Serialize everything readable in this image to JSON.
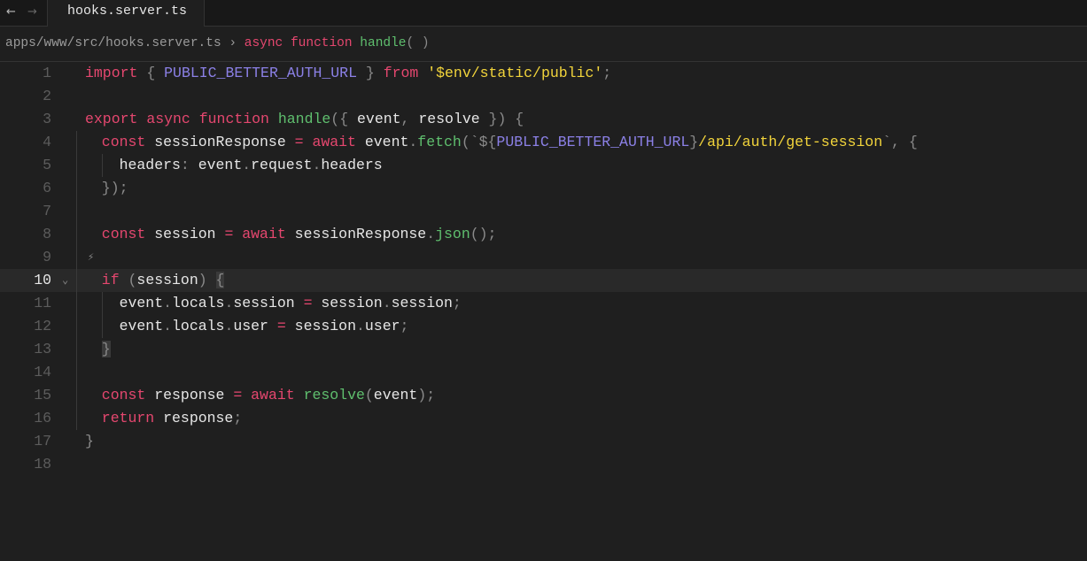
{
  "nav": {
    "back": "←",
    "forward": "→"
  },
  "tab": {
    "label": "hooks.server.ts"
  },
  "breadcrumb": {
    "path": "apps/www/src/hooks.server.ts",
    "sep": "›",
    "kw1": "async",
    "kw2": "function",
    "fn": "handle",
    "parens": "( )"
  },
  "current_line": 10,
  "colors": {
    "keyword": "#e5476f",
    "function": "#5fbf6e",
    "constant": "#8b80e6",
    "string": "#f2d43b",
    "punct": "#8a8a8a",
    "text": "#e6e6e6"
  },
  "lines": [
    {
      "n": "1",
      "indent": 0,
      "t": [
        [
          "kw",
          "import"
        ],
        [
          "pn",
          " { "
        ],
        [
          "cst",
          "PUBLIC_BETTER_AUTH_URL"
        ],
        [
          "pn",
          " } "
        ],
        [
          "kw",
          "from"
        ],
        [
          "pn",
          " "
        ],
        [
          "str",
          "'$env/static/public'"
        ],
        [
          "pn",
          ";"
        ]
      ]
    },
    {
      "n": "2",
      "indent": 0,
      "t": []
    },
    {
      "n": "3",
      "indent": 0,
      "t": [
        [
          "kw",
          "export"
        ],
        [
          "pn",
          " "
        ],
        [
          "kw",
          "async"
        ],
        [
          "pn",
          " "
        ],
        [
          "kw",
          "function"
        ],
        [
          "pn",
          " "
        ],
        [
          "fn",
          "handle"
        ],
        [
          "pn",
          "({ "
        ],
        [
          "id",
          "event"
        ],
        [
          "pn",
          ", "
        ],
        [
          "id",
          "resolve"
        ],
        [
          "pn",
          " }) {"
        ]
      ]
    },
    {
      "n": "4",
      "indent": 1,
      "t": [
        [
          "kw",
          "const"
        ],
        [
          "id",
          " sessionResponse "
        ],
        [
          "kw",
          "="
        ],
        [
          "id",
          " "
        ],
        [
          "kw",
          "await"
        ],
        [
          "id",
          " event"
        ],
        [
          "pn",
          "."
        ],
        [
          "fn",
          "fetch"
        ],
        [
          "pn",
          "(`${"
        ],
        [
          "cst",
          "PUBLIC_BETTER_AUTH_URL"
        ],
        [
          "pn",
          "}"
        ],
        [
          "str",
          "/api/auth/get-session"
        ],
        [
          "pn",
          "`, {"
        ]
      ]
    },
    {
      "n": "5",
      "indent": 2,
      "t": [
        [
          "id",
          "headers"
        ],
        [
          "pn",
          ": "
        ],
        [
          "id",
          "event"
        ],
        [
          "pn",
          "."
        ],
        [
          "id",
          "request"
        ],
        [
          "pn",
          "."
        ],
        [
          "id",
          "headers"
        ]
      ]
    },
    {
      "n": "6",
      "indent": 1,
      "t": [
        [
          "pn",
          "});"
        ]
      ]
    },
    {
      "n": "7",
      "indent": 1,
      "t": []
    },
    {
      "n": "8",
      "indent": 1,
      "t": [
        [
          "kw",
          "const"
        ],
        [
          "id",
          " session "
        ],
        [
          "kw",
          "="
        ],
        [
          "id",
          " "
        ],
        [
          "kw",
          "await"
        ],
        [
          "id",
          " sessionResponse"
        ],
        [
          "pn",
          "."
        ],
        [
          "fn",
          "json"
        ],
        [
          "pn",
          "();"
        ]
      ]
    },
    {
      "n": "9",
      "indent": 1,
      "t": [],
      "bolt": "⚡"
    },
    {
      "n": "10",
      "indent": 1,
      "t": [
        [
          "kw",
          "if"
        ],
        [
          "pn",
          " ("
        ],
        [
          "id",
          "session"
        ],
        [
          "pn",
          ") "
        ],
        [
          "pn hlb",
          "{"
        ]
      ],
      "fold": "⌄"
    },
    {
      "n": "11",
      "indent": 2,
      "t": [
        [
          "id",
          "event"
        ],
        [
          "pn",
          "."
        ],
        [
          "id",
          "locals"
        ],
        [
          "pn",
          "."
        ],
        [
          "id",
          "session "
        ],
        [
          "kw",
          "="
        ],
        [
          "id",
          " session"
        ],
        [
          "pn",
          "."
        ],
        [
          "id",
          "session"
        ],
        [
          "pn",
          ";"
        ]
      ]
    },
    {
      "n": "12",
      "indent": 2,
      "t": [
        [
          "id",
          "event"
        ],
        [
          "pn",
          "."
        ],
        [
          "id",
          "locals"
        ],
        [
          "pn",
          "."
        ],
        [
          "id",
          "user "
        ],
        [
          "kw",
          "="
        ],
        [
          "id",
          " session"
        ],
        [
          "pn",
          "."
        ],
        [
          "id",
          "user"
        ],
        [
          "pn",
          ";"
        ]
      ]
    },
    {
      "n": "13",
      "indent": 1,
      "t": [
        [
          "pn hlb",
          "}"
        ]
      ]
    },
    {
      "n": "14",
      "indent": 1,
      "t": []
    },
    {
      "n": "15",
      "indent": 1,
      "t": [
        [
          "kw",
          "const"
        ],
        [
          "id",
          " response "
        ],
        [
          "kw",
          "="
        ],
        [
          "id",
          " "
        ],
        [
          "kw",
          "await"
        ],
        [
          "id",
          " "
        ],
        [
          "fn",
          "resolve"
        ],
        [
          "pn",
          "("
        ],
        [
          "id",
          "event"
        ],
        [
          "pn",
          ");"
        ]
      ]
    },
    {
      "n": "16",
      "indent": 1,
      "t": [
        [
          "kw",
          "return"
        ],
        [
          "id",
          " response"
        ],
        [
          "pn",
          ";"
        ]
      ]
    },
    {
      "n": "17",
      "indent": 0,
      "t": [
        [
          "pn",
          "}"
        ]
      ]
    },
    {
      "n": "18",
      "indent": 0,
      "t": []
    }
  ]
}
